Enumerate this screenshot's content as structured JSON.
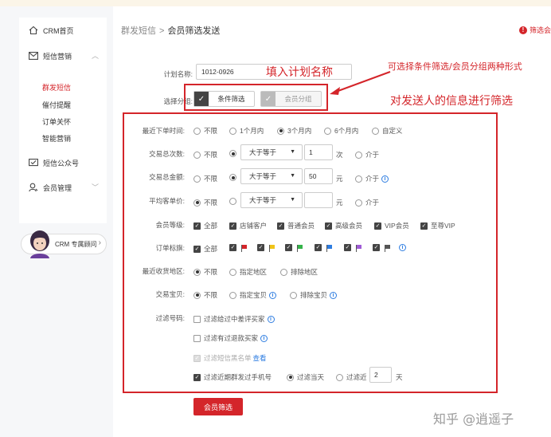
{
  "sidebar": {
    "items": [
      {
        "label": "CRM首页",
        "icon": "home-icon"
      },
      {
        "label": "短信营销",
        "icon": "mail-icon"
      },
      {
        "label": "短信公众号",
        "icon": "message-icon"
      },
      {
        "label": "会员管理",
        "icon": "user-icon"
      }
    ],
    "sub_items": [
      "群发短信",
      "催付提醒",
      "订单关怀",
      "智能营销"
    ],
    "consult_label": "CRM 专属顾问"
  },
  "breadcrumb": {
    "parent": "群发短信",
    "separator": ">",
    "current": "会员筛选发送"
  },
  "warn_text": "筛选会",
  "plan": {
    "label": "计划名称:",
    "value": "1012-0926"
  },
  "group": {
    "label": "选择分组:",
    "tab_condition": "条件筛选",
    "tab_member": "会员分组"
  },
  "annotations": {
    "fill_name": "填入计划名称",
    "two_forms": "可选择条件筛选/会员分组两种形式",
    "filter_info": "对发送人的信息进行筛选"
  },
  "recent_order": {
    "label": "最近下单时间:",
    "options": [
      "不限",
      "1个月内",
      "3个月内",
      "6个月内",
      "自定义"
    ]
  },
  "trade_count": {
    "label": "交易总次数:",
    "opt_none": "不限",
    "select_value": "大于等于",
    "input_value": "1",
    "unit": "次",
    "opt_between": "介于"
  },
  "trade_amount": {
    "label": "交易总金额:",
    "opt_none": "不限",
    "select_value": "大于等于",
    "input_value": "50",
    "unit": "元",
    "opt_between": "介于"
  },
  "avg_price": {
    "label": "平均客单价:",
    "opt_none": "不限",
    "select_value": "大于等于",
    "input_value": "",
    "unit": "元",
    "opt_between": "介于"
  },
  "member_level": {
    "label": "会员等级:",
    "options": [
      "全部",
      "店铺客户",
      "普通会员",
      "高级会员",
      "VIP会员",
      "至尊VIP"
    ]
  },
  "order_flag": {
    "label": "订单标旗:",
    "all": "全部",
    "flag_colors": [
      "#d4252a",
      "#f0c419",
      "#35b34a",
      "#2e7de1",
      "#a05bd6",
      "#555555"
    ]
  },
  "recent_region": {
    "label": "最近收货地区:",
    "options": [
      "不限",
      "指定地区",
      "排除地区"
    ]
  },
  "trade_item": {
    "label": "交易宝贝:",
    "options": [
      "不限",
      "指定宝贝",
      "排除宝贝"
    ]
  },
  "filter_numbers": {
    "label": "过滤号码:",
    "opt1": "过滤给过中差评买家",
    "opt2": "过滤有过退款买家",
    "opt3": "过滤短信黑名单",
    "opt3_link": "查看",
    "opt4": "过滤近期群发过手机号",
    "opt4_today": "过滤当天",
    "opt4_recent": "过滤近",
    "opt4_days": "2",
    "opt4_unit": "天"
  },
  "filter_button": "会员筛选",
  "watermark": "知乎 @逍遥子",
  "colors": {
    "accent": "#d4252a",
    "link": "#2e7de1"
  }
}
